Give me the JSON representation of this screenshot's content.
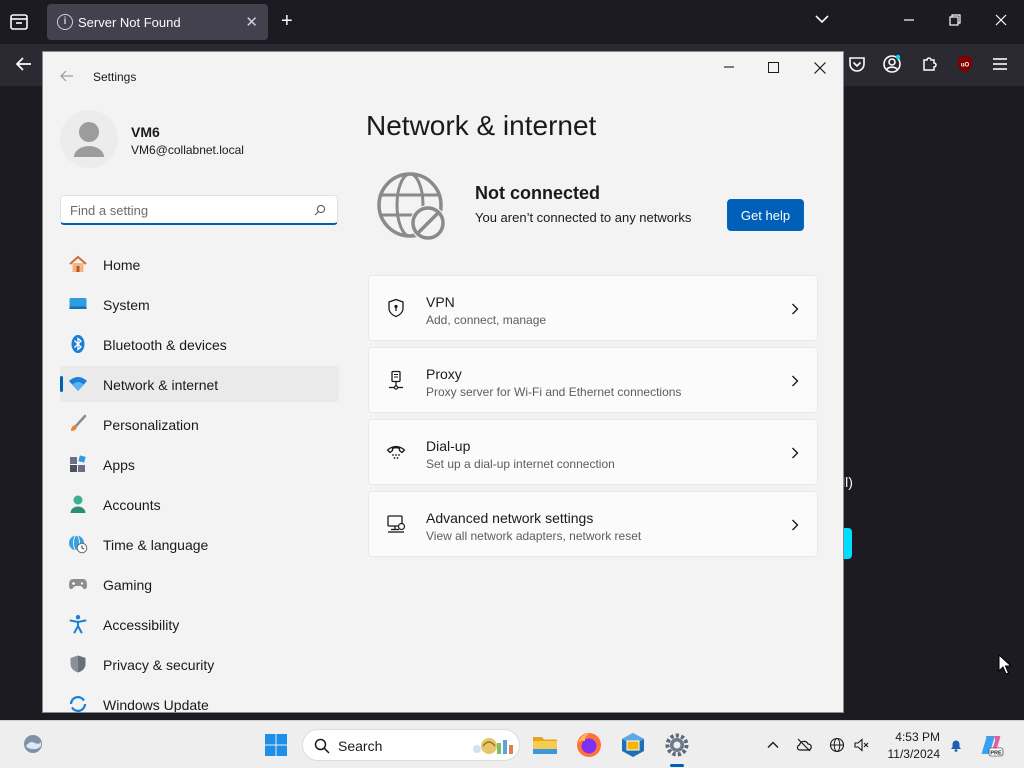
{
  "browser": {
    "tab_title": "Server Not Found",
    "new_tab_symbol": "+",
    "close_symbol": "✕",
    "tab_info_symbol": "i",
    "content_partial_text": "ll)",
    "toolbar_icons": [
      "pocket-icon",
      "account-icon",
      "extensions-icon",
      "ublock-icon",
      "menu-icon"
    ],
    "ublock_text": "uO"
  },
  "settings": {
    "title": "Settings",
    "profile": {
      "name": "VM6",
      "email": "VM6@collabnet.local"
    },
    "search": {
      "placeholder": "Find a setting",
      "value": ""
    },
    "nav": [
      {
        "label": "Home",
        "icon": "home-icon",
        "selected": false
      },
      {
        "label": "System",
        "icon": "system-icon",
        "selected": false
      },
      {
        "label": "Bluetooth & devices",
        "icon": "bluetooth-icon",
        "selected": false
      },
      {
        "label": "Network & internet",
        "icon": "wifi-icon",
        "selected": true
      },
      {
        "label": "Personalization",
        "icon": "brush-icon",
        "selected": false
      },
      {
        "label": "Apps",
        "icon": "apps-icon",
        "selected": false
      },
      {
        "label": "Accounts",
        "icon": "accounts-icon",
        "selected": false
      },
      {
        "label": "Time & language",
        "icon": "globe-clock-icon",
        "selected": false
      },
      {
        "label": "Gaming",
        "icon": "gamepad-icon",
        "selected": false
      },
      {
        "label": "Accessibility",
        "icon": "accessibility-icon",
        "selected": false
      },
      {
        "label": "Privacy & security",
        "icon": "shield-icon",
        "selected": false
      },
      {
        "label": "Windows Update",
        "icon": "update-icon",
        "selected": false
      }
    ],
    "page_title": "Network & internet",
    "status": {
      "title": "Not connected",
      "subtitle": "You aren’t connected to any networks",
      "help_button": "Get help"
    },
    "cards": [
      {
        "title": "VPN",
        "subtitle": "Add, connect, manage",
        "icon": "vpn-shield-icon"
      },
      {
        "title": "Proxy",
        "subtitle": "Proxy server for Wi-Fi and Ethernet connections",
        "icon": "proxy-icon"
      },
      {
        "title": "Dial-up",
        "subtitle": "Set up a dial-up internet connection",
        "icon": "dialup-icon"
      },
      {
        "title": "Advanced network settings",
        "subtitle": "View all network adapters, network reset",
        "icon": "advanced-network-icon"
      }
    ]
  },
  "taskbar": {
    "search_label": "Search",
    "time": "4:53 PM",
    "date": "11/3/2024",
    "copilot_badge": "PRE",
    "pinned_apps": [
      "file-explorer-icon",
      "firefox-icon",
      "virtualbox-icon",
      "settings-app-icon"
    ],
    "tray_icons": [
      "chevron-up-icon",
      "cloud-off-icon",
      "network-globe-icon",
      "volume-icon",
      "notification-bell-icon"
    ]
  },
  "colors": {
    "accent": "#005fb8",
    "browser_bg": "#1c1b22",
    "settings_bg": "#f3f3f3",
    "card_bg": "#fbfbfb"
  }
}
